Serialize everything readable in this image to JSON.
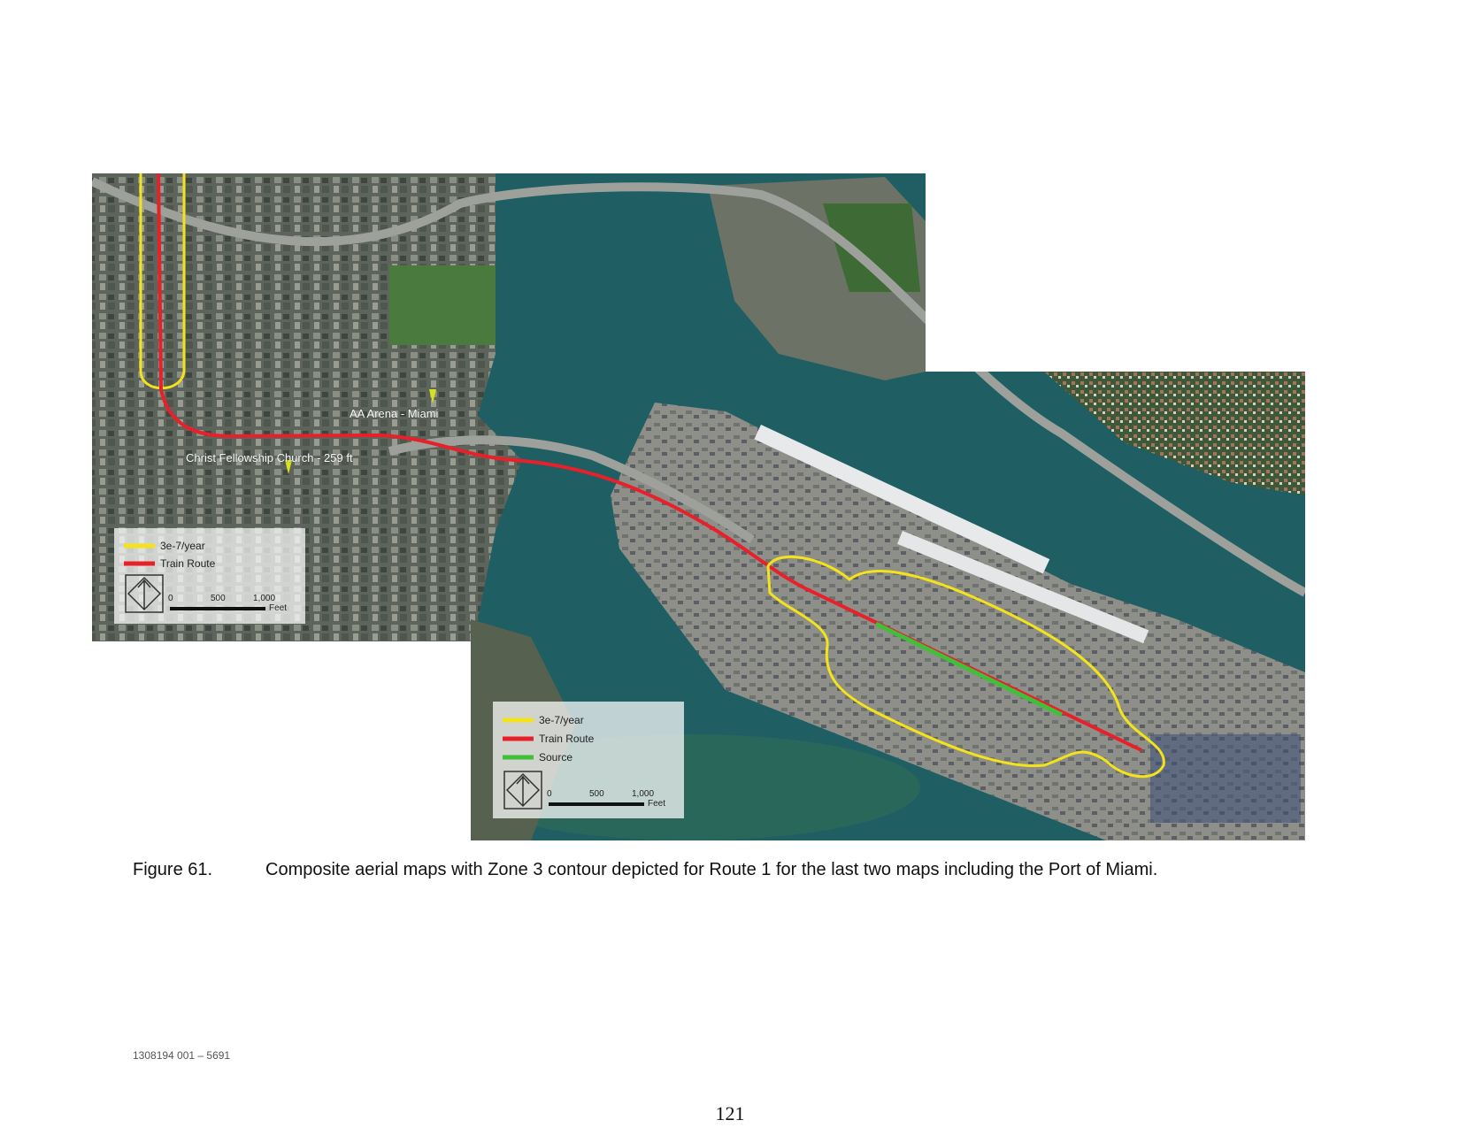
{
  "figure": {
    "number": "Figure 61.",
    "caption": "Composite aerial maps with Zone 3 contour depicted for Route 1 for the last two maps including the Port of Miami."
  },
  "map_labels": {
    "arena": "AA Arena - Miami",
    "church": "Christ Fellowship Church - 259 ft"
  },
  "legend_upper": {
    "items": [
      {
        "label": "3e-7/year",
        "color": "#f4e21b"
      },
      {
        "label": "Train Route",
        "color": "#e8202a"
      }
    ],
    "scale": {
      "ticks": [
        "0",
        "500",
        "1,000"
      ],
      "unit": "Feet"
    }
  },
  "legend_lower": {
    "items": [
      {
        "label": "3e-7/year",
        "color": "#f4e21b"
      },
      {
        "label": "Train Route",
        "color": "#e8202a"
      },
      {
        "label": "Source",
        "color": "#3fbf3a"
      }
    ],
    "scale": {
      "ticks": [
        "0",
        "500",
        "1,000"
      ],
      "unit": "Feet"
    }
  },
  "colors": {
    "water": "#1f5f64",
    "land": "#6e7468",
    "contour": "#f4e21b",
    "route": "#e8202a",
    "source": "#3fbf3a"
  },
  "footer": {
    "doc_id": "1308194 001 – 5691",
    "page_number": "121"
  }
}
